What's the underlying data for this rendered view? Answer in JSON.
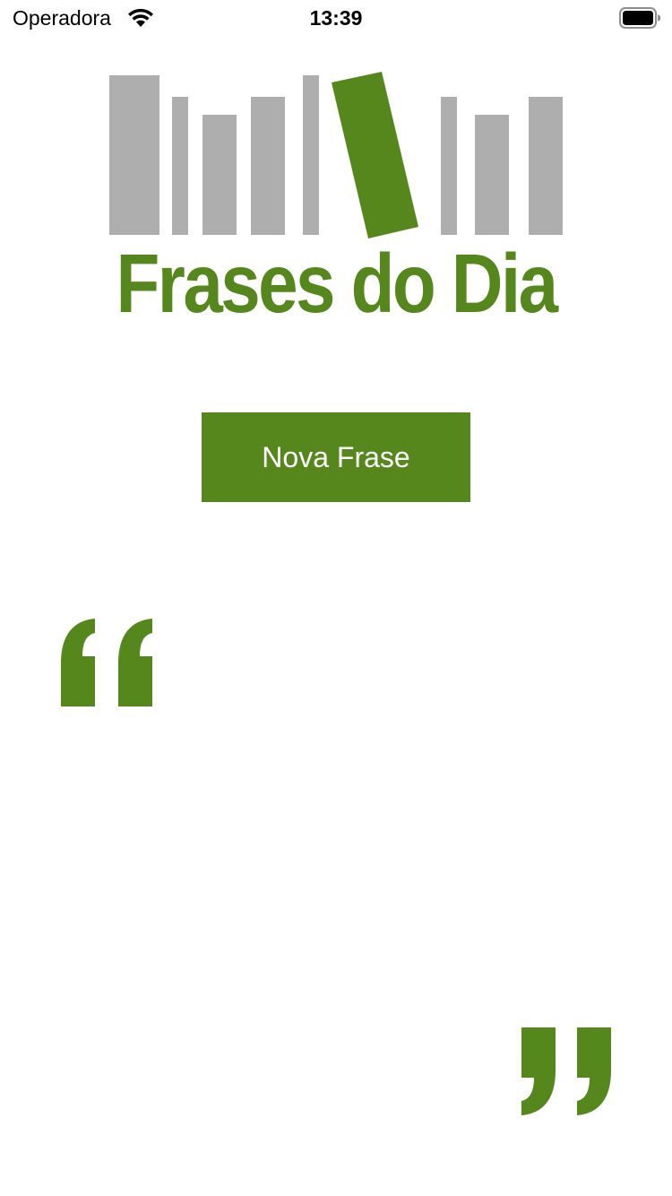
{
  "status_bar": {
    "carrier": "Operadora",
    "time": "13:39",
    "wifi_icon": "wifi-icon",
    "battery_icon": "battery-icon"
  },
  "logo": {
    "title": "Frases do Dia",
    "icon": "books-icon",
    "accent_color": "#55871c",
    "book_color": "#aeaeae"
  },
  "button": {
    "label": "Nova Frase"
  },
  "quote": {
    "open_icon": "open-quote-icon",
    "close_icon": "close-quote-icon",
    "text": ""
  }
}
